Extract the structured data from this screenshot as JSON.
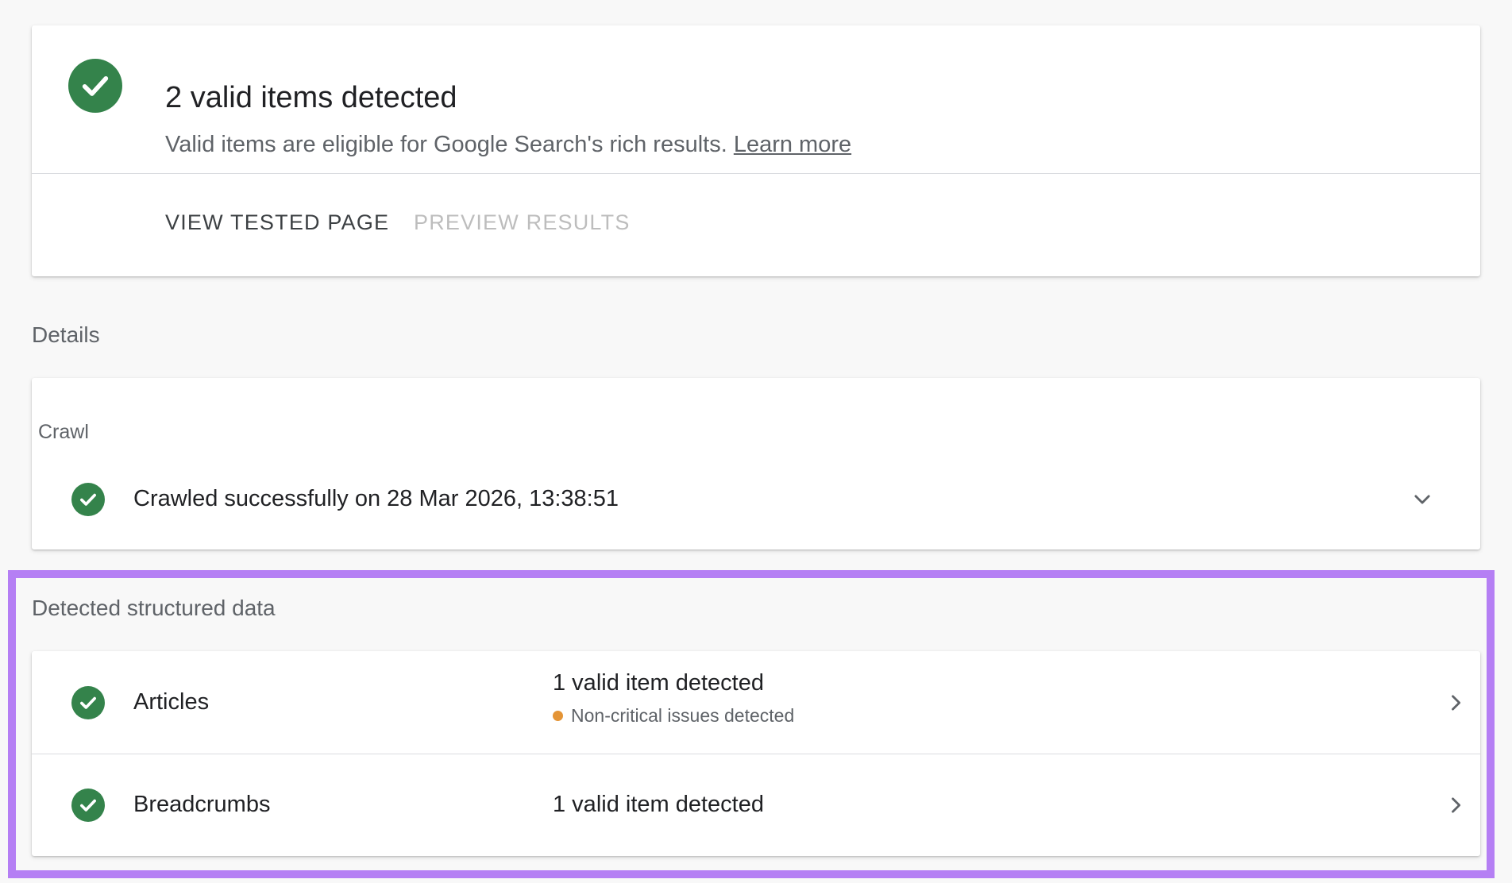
{
  "colors": {
    "success_green": "#34834b",
    "warning_orange": "#e49435",
    "highlight_purple": "#b57ff4"
  },
  "summary": {
    "icon": "check-circle-icon",
    "title": "2 valid items detected",
    "subtitle": "Valid items are eligible for Google Search's rich results.",
    "learn_more": "Learn more",
    "actions": {
      "view_tested_page": "VIEW TESTED PAGE",
      "preview_results": "PREVIEW RESULTS"
    }
  },
  "details": {
    "label": "Details",
    "crawl": {
      "heading": "Crawl",
      "icon": "check-circle-icon",
      "status": "Crawled successfully on 28 Mar 2026, 13:38:51",
      "expand_icon": "chevron-down-icon"
    }
  },
  "structured_data": {
    "label": "Detected structured data",
    "items": [
      {
        "name": "Articles",
        "status": "1 valid item detected",
        "issue": "Non-critical issues detected",
        "icon": "check-circle-icon",
        "nav_icon": "chevron-right-icon"
      },
      {
        "name": "Breadcrumbs",
        "status": "1 valid item detected",
        "icon": "check-circle-icon",
        "nav_icon": "chevron-right-icon"
      }
    ]
  }
}
